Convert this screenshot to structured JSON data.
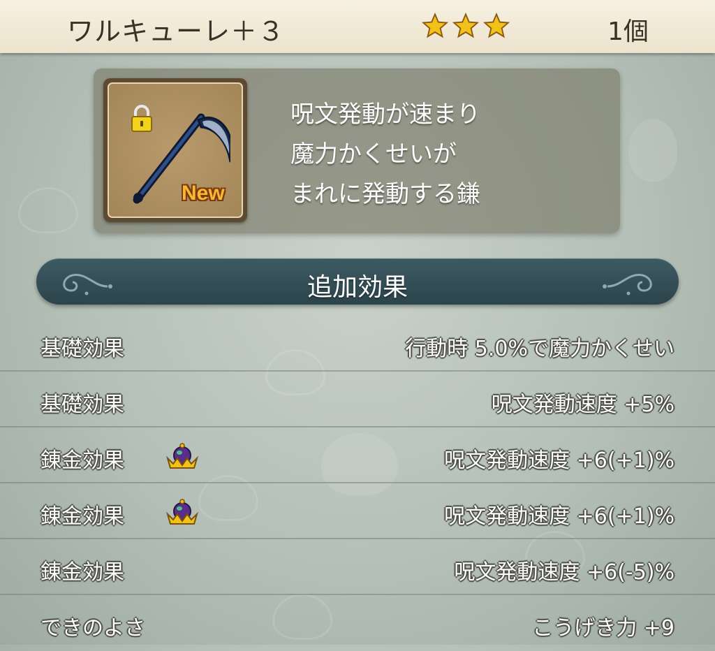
{
  "header": {
    "item_name": "ワルキューレ＋３",
    "rarity_stars": 3,
    "quantity": "1個"
  },
  "item": {
    "icon": "scythe-icon",
    "locked": true,
    "badge": "New",
    "description_lines": [
      "呪文発動が速まり",
      "魔力かくせいが",
      "まれに発動する鎌"
    ]
  },
  "section": {
    "title": "追加効果"
  },
  "effects": [
    {
      "label": "基礎効果",
      "value": "行動時  5.0%で魔力かくせい",
      "crown": false
    },
    {
      "label": "基礎効果",
      "value": "呪文発動速度  +5%",
      "crown": false
    },
    {
      "label": "錬金効果",
      "value": "呪文発動速度  +6(+1)%",
      "crown": true
    },
    {
      "label": "錬金効果",
      "value": "呪文発動速度  +6(+1)%",
      "crown": true
    },
    {
      "label": "錬金効果",
      "value": "呪文発動速度  +6(-5)%",
      "crown": false
    },
    {
      "label": "できのよさ",
      "value": "こうげき力  +9",
      "crown": false
    }
  ],
  "colors": {
    "star": "#f2c21a",
    "banner": "#34505a",
    "badge": "#f7b733"
  }
}
